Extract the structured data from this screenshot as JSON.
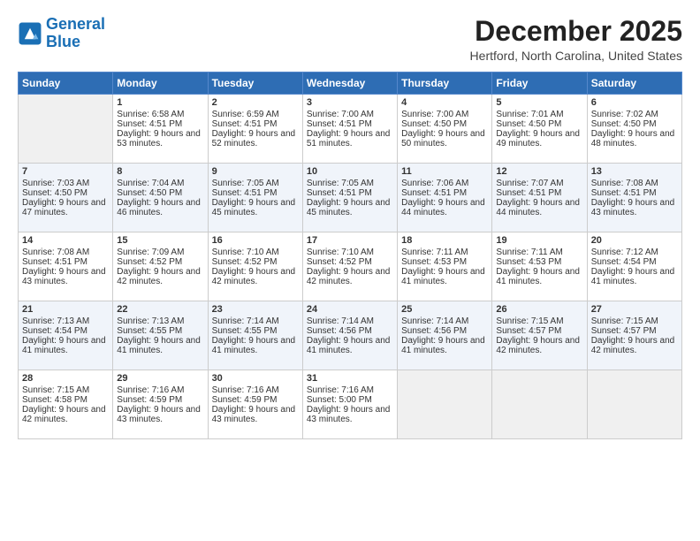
{
  "logo": {
    "line1": "General",
    "line2": "Blue"
  },
  "title": "December 2025",
  "location": "Hertford, North Carolina, United States",
  "days_of_week": [
    "Sunday",
    "Monday",
    "Tuesday",
    "Wednesday",
    "Thursday",
    "Friday",
    "Saturday"
  ],
  "weeks": [
    [
      {
        "day": "",
        "empty": true
      },
      {
        "day": "1",
        "sunrise": "Sunrise: 6:58 AM",
        "sunset": "Sunset: 4:51 PM",
        "daylight": "Daylight: 9 hours and 53 minutes."
      },
      {
        "day": "2",
        "sunrise": "Sunrise: 6:59 AM",
        "sunset": "Sunset: 4:51 PM",
        "daylight": "Daylight: 9 hours and 52 minutes."
      },
      {
        "day": "3",
        "sunrise": "Sunrise: 7:00 AM",
        "sunset": "Sunset: 4:51 PM",
        "daylight": "Daylight: 9 hours and 51 minutes."
      },
      {
        "day": "4",
        "sunrise": "Sunrise: 7:00 AM",
        "sunset": "Sunset: 4:50 PM",
        "daylight": "Daylight: 9 hours and 50 minutes."
      },
      {
        "day": "5",
        "sunrise": "Sunrise: 7:01 AM",
        "sunset": "Sunset: 4:50 PM",
        "daylight": "Daylight: 9 hours and 49 minutes."
      },
      {
        "day": "6",
        "sunrise": "Sunrise: 7:02 AM",
        "sunset": "Sunset: 4:50 PM",
        "daylight": "Daylight: 9 hours and 48 minutes."
      }
    ],
    [
      {
        "day": "7",
        "sunrise": "Sunrise: 7:03 AM",
        "sunset": "Sunset: 4:50 PM",
        "daylight": "Daylight: 9 hours and 47 minutes."
      },
      {
        "day": "8",
        "sunrise": "Sunrise: 7:04 AM",
        "sunset": "Sunset: 4:50 PM",
        "daylight": "Daylight: 9 hours and 46 minutes."
      },
      {
        "day": "9",
        "sunrise": "Sunrise: 7:05 AM",
        "sunset": "Sunset: 4:51 PM",
        "daylight": "Daylight: 9 hours and 45 minutes."
      },
      {
        "day": "10",
        "sunrise": "Sunrise: 7:05 AM",
        "sunset": "Sunset: 4:51 PM",
        "daylight": "Daylight: 9 hours and 45 minutes."
      },
      {
        "day": "11",
        "sunrise": "Sunrise: 7:06 AM",
        "sunset": "Sunset: 4:51 PM",
        "daylight": "Daylight: 9 hours and 44 minutes."
      },
      {
        "day": "12",
        "sunrise": "Sunrise: 7:07 AM",
        "sunset": "Sunset: 4:51 PM",
        "daylight": "Daylight: 9 hours and 44 minutes."
      },
      {
        "day": "13",
        "sunrise": "Sunrise: 7:08 AM",
        "sunset": "Sunset: 4:51 PM",
        "daylight": "Daylight: 9 hours and 43 minutes."
      }
    ],
    [
      {
        "day": "14",
        "sunrise": "Sunrise: 7:08 AM",
        "sunset": "Sunset: 4:51 PM",
        "daylight": "Daylight: 9 hours and 43 minutes."
      },
      {
        "day": "15",
        "sunrise": "Sunrise: 7:09 AM",
        "sunset": "Sunset: 4:52 PM",
        "daylight": "Daylight: 9 hours and 42 minutes."
      },
      {
        "day": "16",
        "sunrise": "Sunrise: 7:10 AM",
        "sunset": "Sunset: 4:52 PM",
        "daylight": "Daylight: 9 hours and 42 minutes."
      },
      {
        "day": "17",
        "sunrise": "Sunrise: 7:10 AM",
        "sunset": "Sunset: 4:52 PM",
        "daylight": "Daylight: 9 hours and 42 minutes."
      },
      {
        "day": "18",
        "sunrise": "Sunrise: 7:11 AM",
        "sunset": "Sunset: 4:53 PM",
        "daylight": "Daylight: 9 hours and 41 minutes."
      },
      {
        "day": "19",
        "sunrise": "Sunrise: 7:11 AM",
        "sunset": "Sunset: 4:53 PM",
        "daylight": "Daylight: 9 hours and 41 minutes."
      },
      {
        "day": "20",
        "sunrise": "Sunrise: 7:12 AM",
        "sunset": "Sunset: 4:54 PM",
        "daylight": "Daylight: 9 hours and 41 minutes."
      }
    ],
    [
      {
        "day": "21",
        "sunrise": "Sunrise: 7:13 AM",
        "sunset": "Sunset: 4:54 PM",
        "daylight": "Daylight: 9 hours and 41 minutes."
      },
      {
        "day": "22",
        "sunrise": "Sunrise: 7:13 AM",
        "sunset": "Sunset: 4:55 PM",
        "daylight": "Daylight: 9 hours and 41 minutes."
      },
      {
        "day": "23",
        "sunrise": "Sunrise: 7:14 AM",
        "sunset": "Sunset: 4:55 PM",
        "daylight": "Daylight: 9 hours and 41 minutes."
      },
      {
        "day": "24",
        "sunrise": "Sunrise: 7:14 AM",
        "sunset": "Sunset: 4:56 PM",
        "daylight": "Daylight: 9 hours and 41 minutes."
      },
      {
        "day": "25",
        "sunrise": "Sunrise: 7:14 AM",
        "sunset": "Sunset: 4:56 PM",
        "daylight": "Daylight: 9 hours and 41 minutes."
      },
      {
        "day": "26",
        "sunrise": "Sunrise: 7:15 AM",
        "sunset": "Sunset: 4:57 PM",
        "daylight": "Daylight: 9 hours and 42 minutes."
      },
      {
        "day": "27",
        "sunrise": "Sunrise: 7:15 AM",
        "sunset": "Sunset: 4:57 PM",
        "daylight": "Daylight: 9 hours and 42 minutes."
      }
    ],
    [
      {
        "day": "28",
        "sunrise": "Sunrise: 7:15 AM",
        "sunset": "Sunset: 4:58 PM",
        "daylight": "Daylight: 9 hours and 42 minutes."
      },
      {
        "day": "29",
        "sunrise": "Sunrise: 7:16 AM",
        "sunset": "Sunset: 4:59 PM",
        "daylight": "Daylight: 9 hours and 43 minutes."
      },
      {
        "day": "30",
        "sunrise": "Sunrise: 7:16 AM",
        "sunset": "Sunset: 4:59 PM",
        "daylight": "Daylight: 9 hours and 43 minutes."
      },
      {
        "day": "31",
        "sunrise": "Sunrise: 7:16 AM",
        "sunset": "Sunset: 5:00 PM",
        "daylight": "Daylight: 9 hours and 43 minutes."
      },
      {
        "day": "",
        "empty": true
      },
      {
        "day": "",
        "empty": true
      },
      {
        "day": "",
        "empty": true
      }
    ]
  ]
}
